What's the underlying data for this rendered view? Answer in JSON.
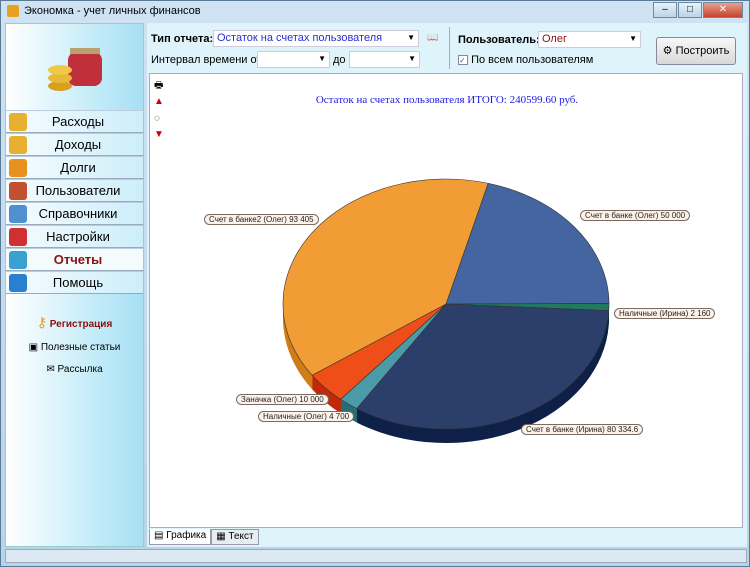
{
  "window": {
    "title": "Экономка - учет личных финансов",
    "min": "–",
    "max": "□",
    "close": "✕"
  },
  "sidebar": {
    "items": [
      {
        "label": "Расходы",
        "icon": "coins-minus-icon",
        "color": "#e8b030"
      },
      {
        "label": "Доходы",
        "icon": "coins-plus-icon",
        "color": "#e8b030"
      },
      {
        "label": "Долги",
        "icon": "percent-icon",
        "color": "#e89020"
      },
      {
        "label": "Пользователи",
        "icon": "users-icon",
        "color": "#c05030"
      },
      {
        "label": "Справочники",
        "icon": "document-check-icon",
        "color": "#5090d0"
      },
      {
        "label": "Настройки",
        "icon": "tools-icon",
        "color": "#d03030"
      },
      {
        "label": "Отчеты",
        "icon": "pie-chart-icon",
        "color": "#3aa0d0"
      },
      {
        "label": "Помощь",
        "icon": "help-icon",
        "color": "#2a80d0"
      }
    ],
    "links": {
      "register": "Регистрация",
      "articles": "Полезные статьи",
      "mailing": "Рассылка"
    }
  },
  "toolbar": {
    "report_type_label": "Тип отчета:",
    "report_type_value": "Остаток на счетах пользователя",
    "interval_label": "Интервал времени от",
    "to_label": "до",
    "from_value": "",
    "to_value": "",
    "user_label": "Пользователь:",
    "user_value": "Олег",
    "all_users_label": "По всем пользователям",
    "all_users_checked": true,
    "build_label": "Построить"
  },
  "tabs": [
    {
      "label": "Графика"
    },
    {
      "label": "Текст"
    }
  ],
  "chart_data": {
    "type": "pie",
    "title": "Остаток на счетах пользователя ИТОГО: 240599.60 руб.",
    "slices": [
      {
        "label": "Счет в банке (Олег)",
        "display": "Счет в банке (Олег)  50 000",
        "value": 50000,
        "color": "#4465a0",
        "side": "#2a4578"
      },
      {
        "label": "Наличные (Ирина)",
        "display": "Наличные (Ирина)  2 160",
        "value": 2160,
        "color": "#1f7a60",
        "side": "#145040"
      },
      {
        "label": "Счет в банке (Ирина)",
        "display": "Счет в банке (Ирина)  80 334.6",
        "value": 80334.6,
        "color": "#2c3f6b",
        "side": "#0f2148"
      },
      {
        "label": "Наличные (Олег)",
        "display": "Наличные (Олег)  4 700",
        "value": 4700,
        "color": "#4a9aa8",
        "side": "#2a6c78"
      },
      {
        "label": "Заначка (Олег)",
        "display": "Заначка (Олег)  10 000",
        "value": 10000,
        "color": "#ee4f18",
        "side": "#c02a08"
      },
      {
        "label": "Счет в банке2 (Олег)",
        "display": "Счет в банке2 (Олег)  93 405",
        "value": 93405,
        "color": "#f29c35",
        "side": "#d07d18"
      }
    ]
  }
}
